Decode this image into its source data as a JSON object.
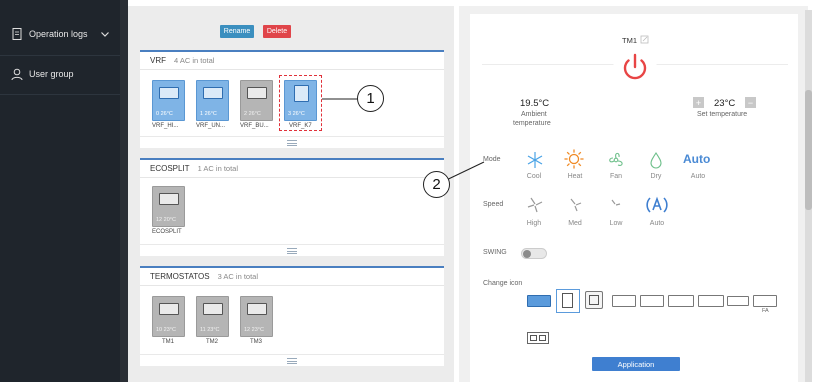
{
  "sidebar": {
    "items": [
      {
        "label": "Operation logs"
      },
      {
        "label": "User group"
      }
    ]
  },
  "toolbar": {
    "rename_label": "Rename",
    "delete_label": "Delete"
  },
  "groups": [
    {
      "title": "VRF",
      "count": "4 AC in total",
      "tiles": [
        {
          "label": "VRF_HI...",
          "value": "0  26°C",
          "state": "on"
        },
        {
          "label": "VRF_UN...",
          "value": "1  26°C",
          "state": "on"
        },
        {
          "label": "VRF_BU...",
          "value": "2  26°C",
          "state": "off"
        },
        {
          "label": "VRF_K7",
          "value": "3  26°C",
          "state": "on"
        }
      ]
    },
    {
      "title": "ECOSPLIT",
      "count": "1 AC in total",
      "tiles": [
        {
          "label": "ECOSPLIT",
          "value": "12  20°C",
          "state": "off"
        }
      ]
    },
    {
      "title": "TERMOSTATOS",
      "count": "3 AC in total",
      "tiles": [
        {
          "label": "TM1",
          "value": "10  23°C",
          "state": "off"
        },
        {
          "label": "TM2",
          "value": "11  23°C",
          "state": "off"
        },
        {
          "label": "TM3",
          "value": "12  23°C",
          "state": "off"
        }
      ]
    }
  ],
  "callouts": {
    "one": "1",
    "two": "2"
  },
  "detail": {
    "name": "TM1",
    "ambient_value": "19.5°C",
    "ambient_label_1": "Ambient",
    "ambient_label_2": "temperature",
    "set_value": "23°C",
    "set_label": "Set temperature",
    "mode_label": "Mode",
    "modes": [
      "Cool",
      "Heat",
      "Fan",
      "Dry",
      "Auto"
    ],
    "auto_big": "Auto",
    "speed_label": "Speed",
    "speeds": [
      "High",
      "Med",
      "Low",
      "Auto"
    ],
    "swing_label": "SWING",
    "change_icon_label": "Change icon",
    "fa_label": "FA",
    "apply_label": "Application",
    "plus_symbol": "+",
    "minus_symbol": "−",
    "accent": "#3f7fd0",
    "power_color": "#e84545",
    "heat_color": "#f08a24",
    "cool_color": "#4aa3e6"
  }
}
